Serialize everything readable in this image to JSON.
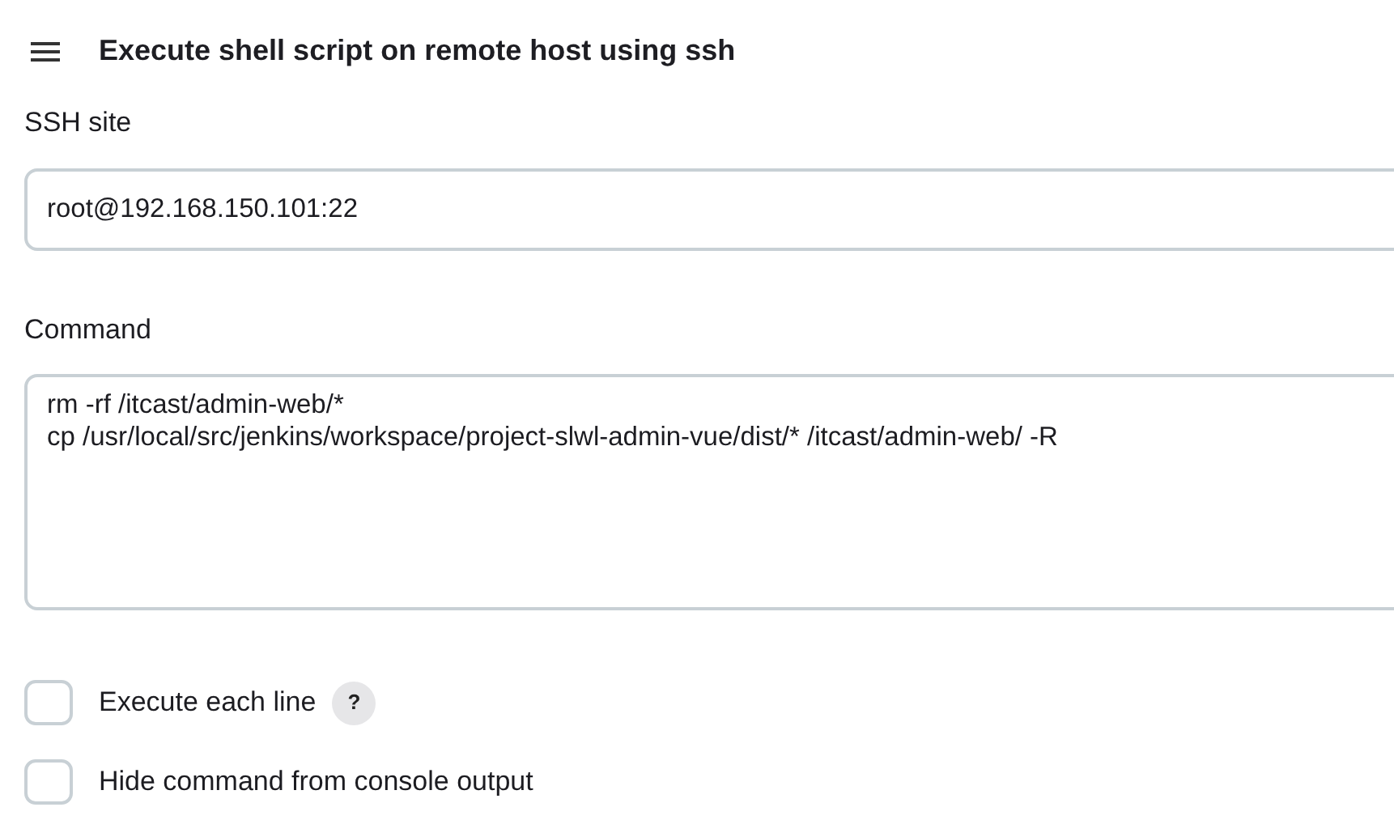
{
  "section": {
    "title": "Execute shell script on remote host using ssh"
  },
  "ssh_site": {
    "label": "SSH site",
    "value": "root@192.168.150.101:22"
  },
  "command": {
    "label": "Command",
    "value": "rm -rf /itcast/admin-web/*\ncp /usr/local/src/jenkins/workspace/project-slwl-admin-vue/dist/* /itcast/admin-web/ -R"
  },
  "options": [
    {
      "label": "Execute each line",
      "checked": false,
      "help": "?"
    },
    {
      "label": "Hide command from console output",
      "checked": false
    }
  ]
}
